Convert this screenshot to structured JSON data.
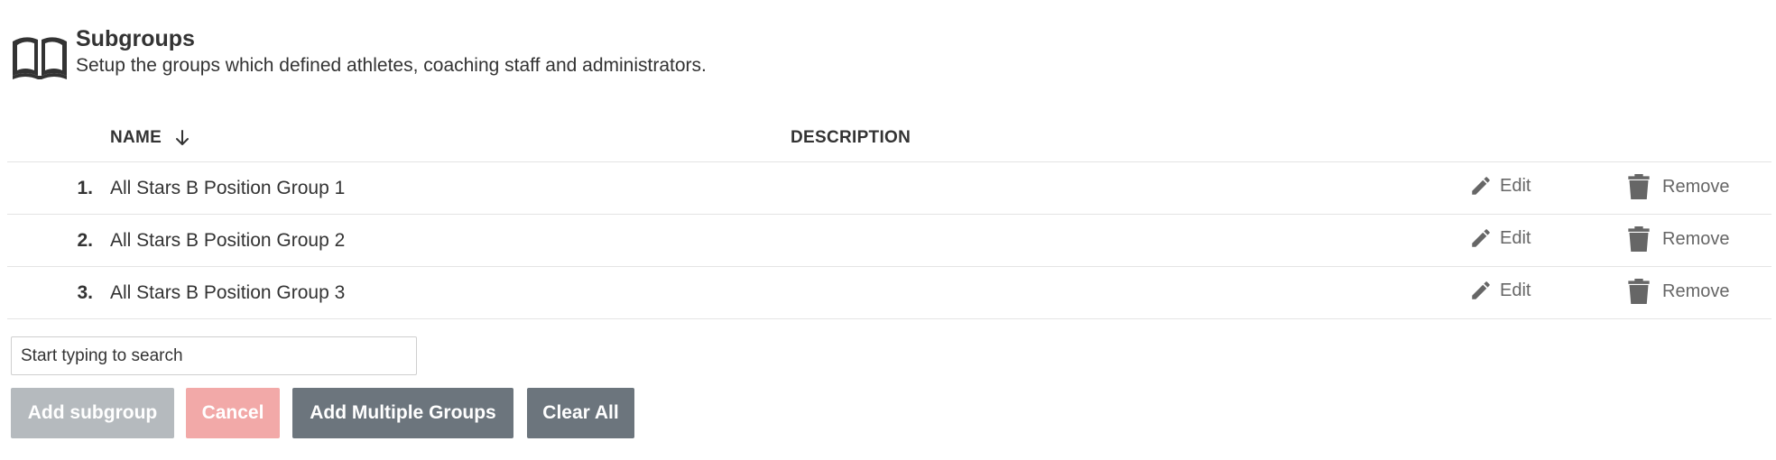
{
  "header": {
    "icon": "book-open-icon",
    "title": "Subgroups",
    "subtitle": "Setup the groups which defined athletes, coaching staff and administrators."
  },
  "table": {
    "columns": {
      "name": "NAME",
      "description": "DESCRIPTION"
    },
    "sort": {
      "column": "name",
      "direction": "descending",
      "icon": "arrow-down-icon"
    },
    "rows": [
      {
        "index": "1.",
        "name": "All Stars B Position Group 1",
        "description": "",
        "edit_label": "Edit",
        "remove_label": "Remove"
      },
      {
        "index": "2.",
        "name": "All Stars B Position Group 2",
        "description": "",
        "edit_label": "Edit",
        "remove_label": "Remove"
      },
      {
        "index": "3.",
        "name": "All Stars B Position Group 3",
        "description": "",
        "edit_label": "Edit",
        "remove_label": "Remove"
      }
    ]
  },
  "search": {
    "placeholder": "Start typing to search",
    "value": ""
  },
  "buttons": {
    "add_subgroup": "Add subgroup",
    "cancel": "Cancel",
    "add_multiple": "Add Multiple Groups",
    "clear_all": "Clear All"
  },
  "colors": {
    "text": "#333333",
    "action_text": "#666666",
    "row_border": "#e4e4e4",
    "btn_disabled": "#b5babe",
    "btn_cancel_disabled": "#f2a9a8",
    "btn_secondary": "#6c757d"
  }
}
